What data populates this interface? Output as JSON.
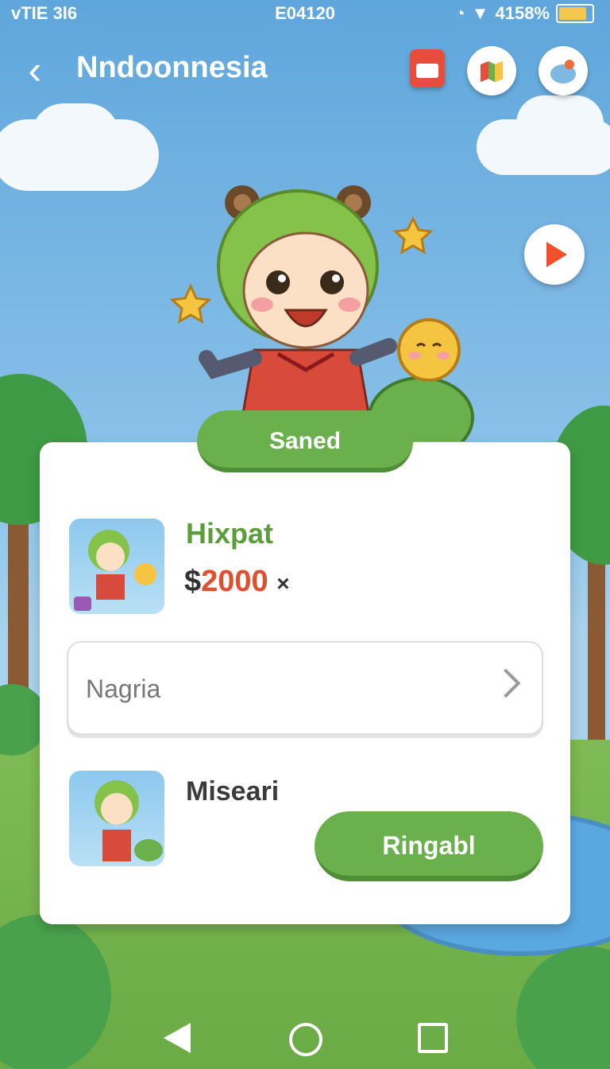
{
  "statusbar": {
    "left": "vTIE 3l6",
    "time": "E04120",
    "battery_text": "4158%",
    "battery_level": 0.9
  },
  "header": {
    "title": "Nndoonnesia",
    "back_icon": "back-arrow-icon"
  },
  "header_icons": [
    "calendar-icon",
    "map-icon",
    "profile-icon"
  ],
  "play_icon": "play-icon",
  "card": {
    "tag": "Saned",
    "product": {
      "name": "Hixpat",
      "currency": "$",
      "price": "2000",
      "mult": "×"
    },
    "select": {
      "label": "Nagria"
    },
    "second": {
      "name": "Miseari",
      "button": "Ringabl"
    }
  },
  "colors": {
    "accent": "#6ab04c",
    "price": "#e0502f",
    "title_green": "#5a9d3a"
  }
}
